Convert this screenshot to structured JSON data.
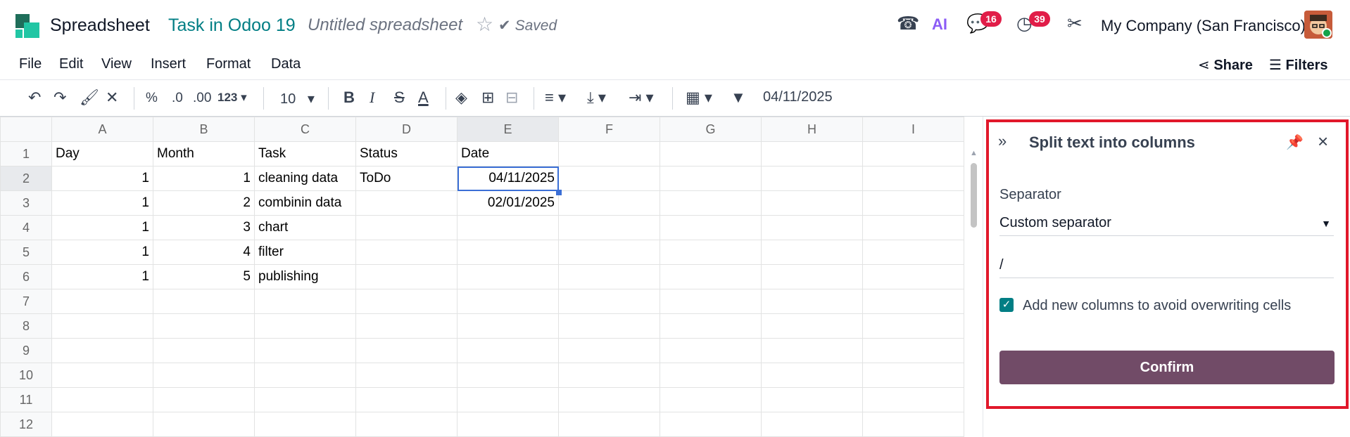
{
  "topbar": {
    "app_name": "Spreadsheet",
    "breadcrumb": "Task in Odoo 19",
    "doc_title": "Untitled spreadsheet",
    "saved_label": "Saved",
    "messages_count": "16",
    "activities_count": "39",
    "company": "My Company (San Francisco)",
    "ai_label": "AI"
  },
  "menubar": {
    "items": [
      "File",
      "Edit",
      "View",
      "Insert",
      "Format",
      "Data"
    ],
    "share_label": "Share",
    "filters_label": "Filters"
  },
  "toolbar": {
    "percent": "%",
    "dec_decrease": ".0",
    "dec_increase": ".00",
    "more_formats": "123",
    "font_size": "10",
    "bold": "B",
    "italic": "I",
    "strike": "S",
    "text_color": "A",
    "formula_value": "04/11/2025"
  },
  "grid": {
    "columns": [
      "A",
      "B",
      "C",
      "D",
      "E",
      "F",
      "G",
      "H",
      "I"
    ],
    "rows": [
      {
        "n": "1",
        "cells": [
          "Day",
          "Month",
          "Task",
          "Status",
          "Date",
          "",
          "",
          "",
          ""
        ]
      },
      {
        "n": "2",
        "cells": [
          "1",
          "1",
          "cleaning data",
          "ToDo",
          "04/11/2025",
          "",
          "",
          "",
          ""
        ]
      },
      {
        "n": "3",
        "cells": [
          "1",
          "2",
          "combinin data",
          "",
          "02/01/2025",
          "",
          "",
          "",
          ""
        ]
      },
      {
        "n": "4",
        "cells": [
          "1",
          "3",
          "chart",
          "",
          "",
          "",
          "",
          "",
          ""
        ]
      },
      {
        "n": "5",
        "cells": [
          "1",
          "4",
          "filter",
          "",
          "",
          "",
          "",
          "",
          ""
        ]
      },
      {
        "n": "6",
        "cells": [
          "1",
          "5",
          "publishing",
          "",
          "",
          "",
          "",
          "",
          ""
        ]
      },
      {
        "n": "7",
        "cells": [
          "",
          "",
          "",
          "",
          "",
          "",
          "",
          "",
          ""
        ]
      },
      {
        "n": "8",
        "cells": [
          "",
          "",
          "",
          "",
          "",
          "",
          "",
          "",
          ""
        ]
      },
      {
        "n": "9",
        "cells": [
          "",
          "",
          "",
          "",
          "",
          "",
          "",
          "",
          ""
        ]
      },
      {
        "n": "10",
        "cells": [
          "",
          "",
          "",
          "",
          "",
          "",
          "",
          "",
          ""
        ]
      },
      {
        "n": "11",
        "cells": [
          "",
          "",
          "",
          "",
          "",
          "",
          "",
          "",
          ""
        ]
      },
      {
        "n": "12",
        "cells": [
          "",
          "",
          "",
          "",
          "",
          "",
          "",
          "",
          ""
        ]
      }
    ],
    "selected_cell": "E2"
  },
  "panel": {
    "title": "Split text into columns",
    "separator_label": "Separator",
    "separator_value": "Custom separator",
    "custom_value": "/",
    "checkbox_label": "Add new columns to avoid overwriting cells",
    "checkbox_checked": true,
    "confirm_label": "Confirm"
  },
  "colors": {
    "brand_teal": "#017e84",
    "confirm_purple": "#714b67",
    "badge_red": "#e11d48",
    "highlight_red": "#e1182b",
    "selection_blue": "#3b6fd6"
  }
}
